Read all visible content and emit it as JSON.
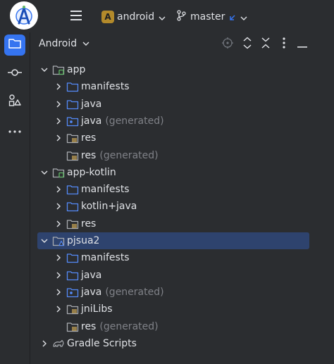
{
  "topbar": {
    "project_initial": "A",
    "project_name": "android",
    "branch_name": "master",
    "colors": {
      "project_badge": "#b38a2b",
      "branch_arrow": "#3574f0"
    }
  },
  "toolstrip": {
    "items": [
      {
        "icon": "folder-icon",
        "active": true
      },
      {
        "icon": "commit-icon",
        "active": false
      },
      {
        "icon": "structure-icon",
        "active": false
      },
      {
        "icon": "more-icon",
        "active": false
      }
    ]
  },
  "panel": {
    "title": "Android",
    "actions": [
      "locate-icon",
      "expand-all-icon",
      "collapse-all-icon",
      "options-icon",
      "hide-icon"
    ]
  },
  "tree": [
    {
      "label": "app",
      "note": "",
      "level": 0,
      "expanded": true,
      "icon": "module",
      "selected": false,
      "has_chevron": true
    },
    {
      "label": "manifests",
      "note": "",
      "level": 1,
      "expanded": false,
      "icon": "folder-blue",
      "selected": false,
      "has_chevron": true
    },
    {
      "label": "java",
      "note": "",
      "level": 1,
      "expanded": false,
      "icon": "folder-blue",
      "selected": false,
      "has_chevron": true
    },
    {
      "label": "java",
      "note": "(generated)",
      "level": 1,
      "expanded": false,
      "icon": "folder-generated",
      "selected": false,
      "has_chevron": true
    },
    {
      "label": "res",
      "note": "",
      "level": 1,
      "expanded": false,
      "icon": "folder-res",
      "selected": false,
      "has_chevron": true
    },
    {
      "label": "res",
      "note": "(generated)",
      "level": 1,
      "expanded": false,
      "icon": "folder-res",
      "selected": false,
      "has_chevron": false
    },
    {
      "label": "app-kotlin",
      "note": "",
      "level": 0,
      "expanded": true,
      "icon": "module",
      "selected": false,
      "has_chevron": true
    },
    {
      "label": "manifests",
      "note": "",
      "level": 1,
      "expanded": false,
      "icon": "folder-blue",
      "selected": false,
      "has_chevron": true
    },
    {
      "label": "kotlin+java",
      "note": "",
      "level": 1,
      "expanded": false,
      "icon": "folder-blue",
      "selected": false,
      "has_chevron": true
    },
    {
      "label": "res",
      "note": "",
      "level": 1,
      "expanded": false,
      "icon": "folder-res",
      "selected": false,
      "has_chevron": true
    },
    {
      "label": "pjsua2",
      "note": "",
      "level": 0,
      "expanded": true,
      "icon": "module-lib",
      "selected": true,
      "has_chevron": true
    },
    {
      "label": "manifests",
      "note": "",
      "level": 1,
      "expanded": false,
      "icon": "folder-blue",
      "selected": false,
      "has_chevron": true
    },
    {
      "label": "java",
      "note": "",
      "level": 1,
      "expanded": false,
      "icon": "folder-blue",
      "selected": false,
      "has_chevron": true
    },
    {
      "label": "java",
      "note": "(generated)",
      "level": 1,
      "expanded": false,
      "icon": "folder-generated",
      "selected": false,
      "has_chevron": true
    },
    {
      "label": "jniLibs",
      "note": "",
      "level": 1,
      "expanded": false,
      "icon": "folder-res",
      "selected": false,
      "has_chevron": true
    },
    {
      "label": "res",
      "note": "(generated)",
      "level": 1,
      "expanded": false,
      "icon": "folder-res",
      "selected": false,
      "has_chevron": false
    },
    {
      "label": "Gradle Scripts",
      "note": "",
      "level": 0,
      "expanded": false,
      "icon": "gradle",
      "selected": false,
      "has_chevron": true
    }
  ],
  "colors": {
    "background": "#2b2d30",
    "selection": "#2e436e",
    "accent": "#3574f0",
    "text": "#dfe1e5",
    "muted_text": "#7f8187",
    "folder_blue": "#548af7",
    "res_lines": "#d6ae58",
    "module_green": "#5fb865"
  }
}
